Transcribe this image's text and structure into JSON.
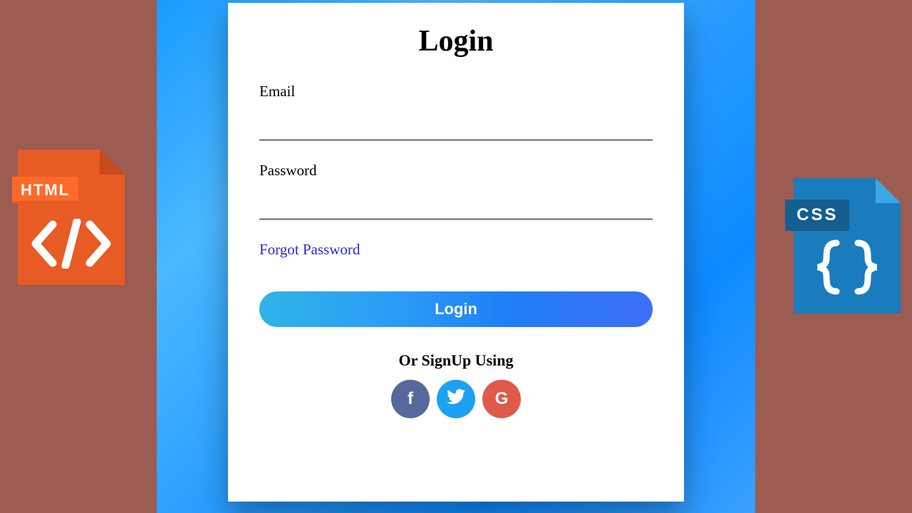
{
  "form": {
    "title": "Login",
    "email_label": "Email",
    "email_value": "",
    "password_label": "Password",
    "password_value": "",
    "forgot_label": "Forgot Password",
    "submit_label": "Login",
    "signup_prompt": "Or SignUp Using",
    "social": {
      "facebook_letter": "f",
      "twitter_letter": "",
      "google_letter": "G"
    }
  },
  "decor": {
    "left_badge": "HTML",
    "right_badge": "CSS"
  },
  "colors": {
    "bg_side": "#9c5c51",
    "accent_gradient_start": "#2fb3e6",
    "accent_gradient_end": "#3e6ef5",
    "facebook": "#556a9a",
    "twitter": "#1da1f2",
    "google": "#e05a4b",
    "link": "#2b27d6"
  }
}
